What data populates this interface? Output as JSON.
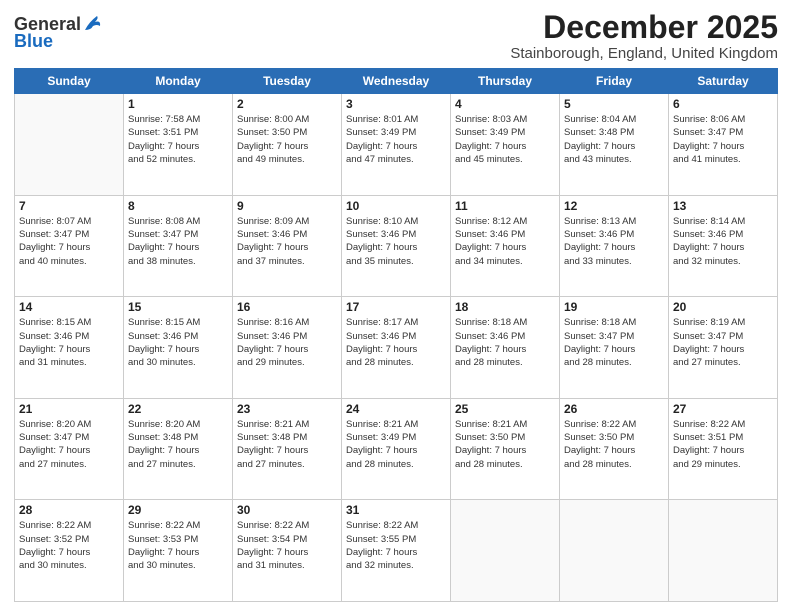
{
  "header": {
    "logo_general": "General",
    "logo_blue": "Blue",
    "title": "December 2025",
    "subtitle": "Stainborough, England, United Kingdom"
  },
  "days_of_week": [
    "Sunday",
    "Monday",
    "Tuesday",
    "Wednesday",
    "Thursday",
    "Friday",
    "Saturday"
  ],
  "weeks": [
    [
      {
        "day": "",
        "info": ""
      },
      {
        "day": "1",
        "info": "Sunrise: 7:58 AM\nSunset: 3:51 PM\nDaylight: 7 hours\nand 52 minutes."
      },
      {
        "day": "2",
        "info": "Sunrise: 8:00 AM\nSunset: 3:50 PM\nDaylight: 7 hours\nand 49 minutes."
      },
      {
        "day": "3",
        "info": "Sunrise: 8:01 AM\nSunset: 3:49 PM\nDaylight: 7 hours\nand 47 minutes."
      },
      {
        "day": "4",
        "info": "Sunrise: 8:03 AM\nSunset: 3:49 PM\nDaylight: 7 hours\nand 45 minutes."
      },
      {
        "day": "5",
        "info": "Sunrise: 8:04 AM\nSunset: 3:48 PM\nDaylight: 7 hours\nand 43 minutes."
      },
      {
        "day": "6",
        "info": "Sunrise: 8:06 AM\nSunset: 3:47 PM\nDaylight: 7 hours\nand 41 minutes."
      }
    ],
    [
      {
        "day": "7",
        "info": "Sunrise: 8:07 AM\nSunset: 3:47 PM\nDaylight: 7 hours\nand 40 minutes."
      },
      {
        "day": "8",
        "info": "Sunrise: 8:08 AM\nSunset: 3:47 PM\nDaylight: 7 hours\nand 38 minutes."
      },
      {
        "day": "9",
        "info": "Sunrise: 8:09 AM\nSunset: 3:46 PM\nDaylight: 7 hours\nand 37 minutes."
      },
      {
        "day": "10",
        "info": "Sunrise: 8:10 AM\nSunset: 3:46 PM\nDaylight: 7 hours\nand 35 minutes."
      },
      {
        "day": "11",
        "info": "Sunrise: 8:12 AM\nSunset: 3:46 PM\nDaylight: 7 hours\nand 34 minutes."
      },
      {
        "day": "12",
        "info": "Sunrise: 8:13 AM\nSunset: 3:46 PM\nDaylight: 7 hours\nand 33 minutes."
      },
      {
        "day": "13",
        "info": "Sunrise: 8:14 AM\nSunset: 3:46 PM\nDaylight: 7 hours\nand 32 minutes."
      }
    ],
    [
      {
        "day": "14",
        "info": "Sunrise: 8:15 AM\nSunset: 3:46 PM\nDaylight: 7 hours\nand 31 minutes."
      },
      {
        "day": "15",
        "info": "Sunrise: 8:15 AM\nSunset: 3:46 PM\nDaylight: 7 hours\nand 30 minutes."
      },
      {
        "day": "16",
        "info": "Sunrise: 8:16 AM\nSunset: 3:46 PM\nDaylight: 7 hours\nand 29 minutes."
      },
      {
        "day": "17",
        "info": "Sunrise: 8:17 AM\nSunset: 3:46 PM\nDaylight: 7 hours\nand 28 minutes."
      },
      {
        "day": "18",
        "info": "Sunrise: 8:18 AM\nSunset: 3:46 PM\nDaylight: 7 hours\nand 28 minutes."
      },
      {
        "day": "19",
        "info": "Sunrise: 8:18 AM\nSunset: 3:47 PM\nDaylight: 7 hours\nand 28 minutes."
      },
      {
        "day": "20",
        "info": "Sunrise: 8:19 AM\nSunset: 3:47 PM\nDaylight: 7 hours\nand 27 minutes."
      }
    ],
    [
      {
        "day": "21",
        "info": "Sunrise: 8:20 AM\nSunset: 3:47 PM\nDaylight: 7 hours\nand 27 minutes."
      },
      {
        "day": "22",
        "info": "Sunrise: 8:20 AM\nSunset: 3:48 PM\nDaylight: 7 hours\nand 27 minutes."
      },
      {
        "day": "23",
        "info": "Sunrise: 8:21 AM\nSunset: 3:48 PM\nDaylight: 7 hours\nand 27 minutes."
      },
      {
        "day": "24",
        "info": "Sunrise: 8:21 AM\nSunset: 3:49 PM\nDaylight: 7 hours\nand 28 minutes."
      },
      {
        "day": "25",
        "info": "Sunrise: 8:21 AM\nSunset: 3:50 PM\nDaylight: 7 hours\nand 28 minutes."
      },
      {
        "day": "26",
        "info": "Sunrise: 8:22 AM\nSunset: 3:50 PM\nDaylight: 7 hours\nand 28 minutes."
      },
      {
        "day": "27",
        "info": "Sunrise: 8:22 AM\nSunset: 3:51 PM\nDaylight: 7 hours\nand 29 minutes."
      }
    ],
    [
      {
        "day": "28",
        "info": "Sunrise: 8:22 AM\nSunset: 3:52 PM\nDaylight: 7 hours\nand 30 minutes."
      },
      {
        "day": "29",
        "info": "Sunrise: 8:22 AM\nSunset: 3:53 PM\nDaylight: 7 hours\nand 30 minutes."
      },
      {
        "day": "30",
        "info": "Sunrise: 8:22 AM\nSunset: 3:54 PM\nDaylight: 7 hours\nand 31 minutes."
      },
      {
        "day": "31",
        "info": "Sunrise: 8:22 AM\nSunset: 3:55 PM\nDaylight: 7 hours\nand 32 minutes."
      },
      {
        "day": "",
        "info": ""
      },
      {
        "day": "",
        "info": ""
      },
      {
        "day": "",
        "info": ""
      }
    ]
  ]
}
